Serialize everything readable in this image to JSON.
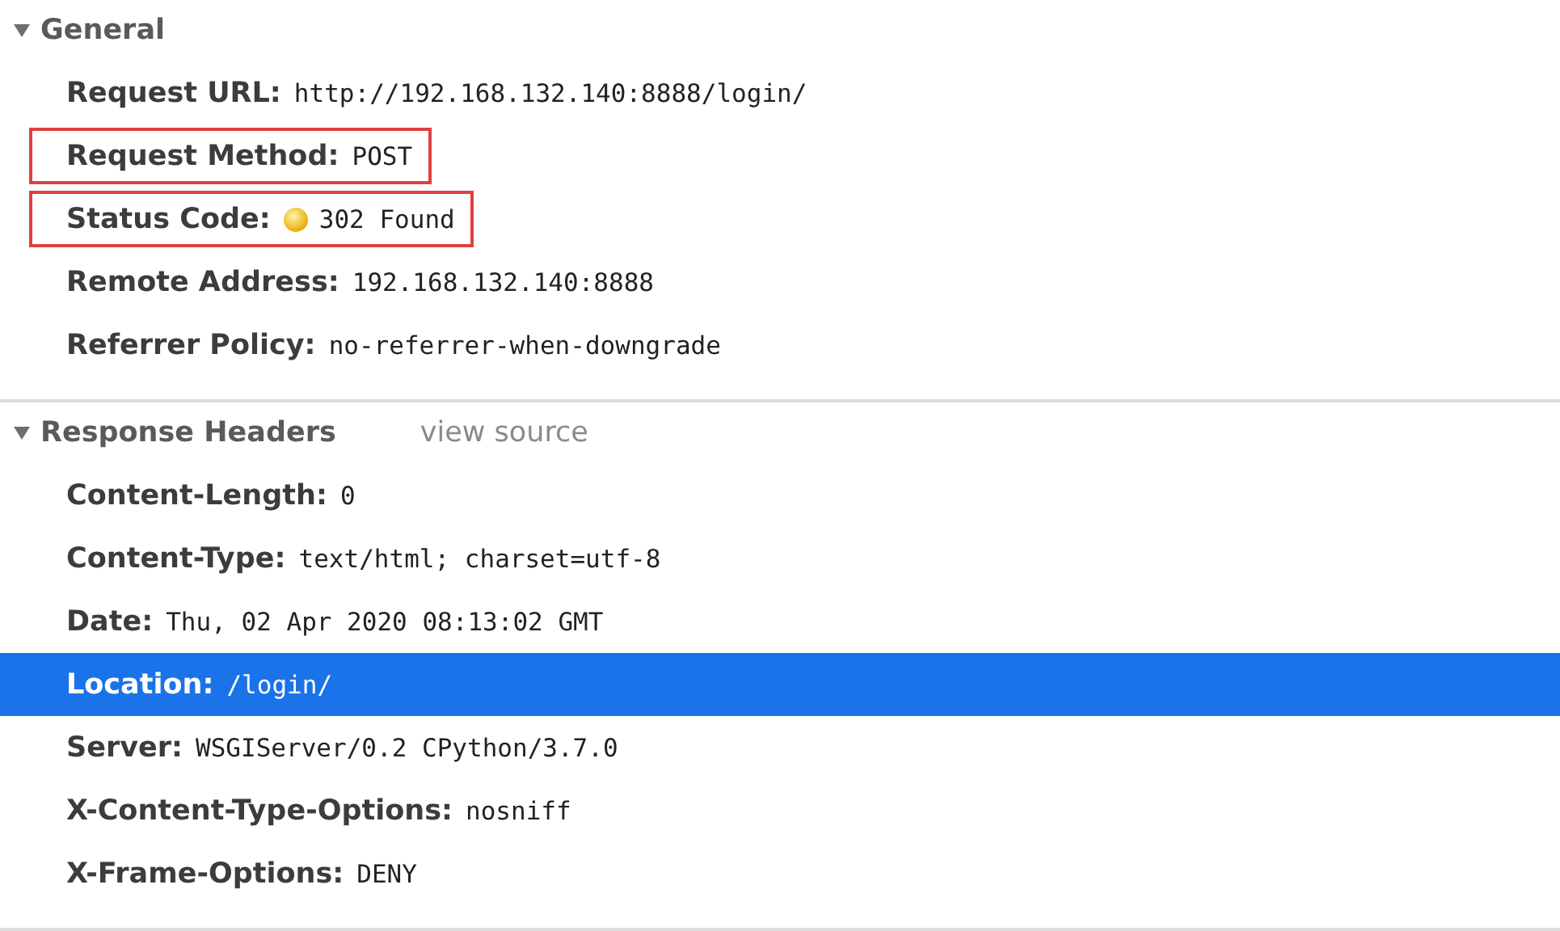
{
  "sections": [
    {
      "title": "General",
      "expanded": true,
      "rows": [
        {
          "label": "Request URL:",
          "value": "http://192.168.132.140:8888/login/",
          "kind": "plain",
          "highlighted": false,
          "selected": false
        },
        {
          "label": "Request Method:",
          "value": "POST",
          "kind": "plain",
          "highlighted": true,
          "selected": false
        },
        {
          "label": "Status Code:",
          "value": "302 Found",
          "kind": "status",
          "highlighted": true,
          "selected": false
        },
        {
          "label": "Remote Address:",
          "value": "192.168.132.140:8888",
          "kind": "plain",
          "highlighted": false,
          "selected": false
        },
        {
          "label": "Referrer Policy:",
          "value": "no-referrer-when-downgrade",
          "kind": "plain",
          "highlighted": false,
          "selected": false
        }
      ]
    },
    {
      "title": "Response Headers",
      "expanded": true,
      "link": "view source",
      "rows": [
        {
          "label": "Content-Length:",
          "value": "0",
          "kind": "plain",
          "highlighted": false,
          "selected": false
        },
        {
          "label": "Content-Type:",
          "value": "text/html; charset=utf-8",
          "kind": "plain",
          "highlighted": false,
          "selected": false
        },
        {
          "label": "Date:",
          "value": "Thu, 02 Apr 2020 08:13:02 GMT",
          "kind": "plain",
          "highlighted": false,
          "selected": false
        },
        {
          "label": "Location:",
          "value": "/login/",
          "kind": "plain",
          "highlighted": false,
          "selected": true
        },
        {
          "label": "Server:",
          "value": "WSGIServer/0.2 CPython/3.7.0",
          "kind": "plain",
          "highlighted": false,
          "selected": false
        },
        {
          "label": "X-Content-Type-Options:",
          "value": "nosniff",
          "kind": "plain",
          "highlighted": false,
          "selected": false
        },
        {
          "label": "X-Frame-Options:",
          "value": "DENY",
          "kind": "plain",
          "highlighted": false,
          "selected": false
        }
      ]
    }
  ]
}
